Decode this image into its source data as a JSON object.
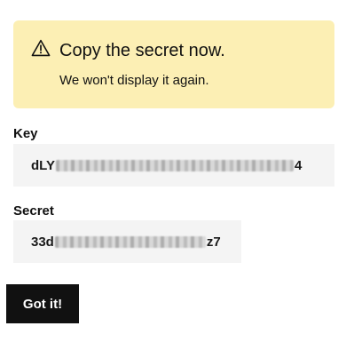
{
  "alert": {
    "icon": "warning-triangle-icon",
    "title": "Copy the secret now.",
    "message": "We won't display it again.",
    "background_color": "#fcefb4"
  },
  "key_field": {
    "label": "Key",
    "value_prefix": "dLY",
    "value_suffix": "4",
    "masked": true
  },
  "secret_field": {
    "label": "Secret",
    "value_prefix": "33d",
    "value_suffix": "z7",
    "masked": true
  },
  "actions": {
    "confirm_label": "Got it!",
    "confirm_color": "#111111"
  }
}
